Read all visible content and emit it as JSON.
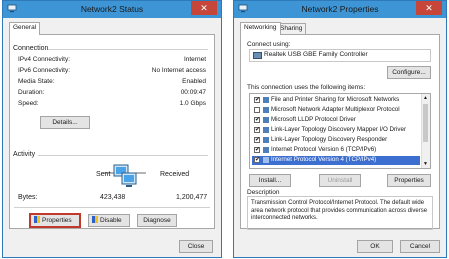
{
  "status_window": {
    "title": "Network2 Status",
    "close_glyph": "✕",
    "tab": "General",
    "connection": {
      "heading": "Connection",
      "rows": [
        {
          "label": "IPv4 Connectivity:",
          "value": "Internet"
        },
        {
          "label": "IPv6 Connectivity:",
          "value": "No Internet access"
        },
        {
          "label": "Media State:",
          "value": "Enabled"
        },
        {
          "label": "Duration:",
          "value": "00:09:47"
        },
        {
          "label": "Speed:",
          "value": "1.0 Gbps"
        }
      ],
      "details_button": "Details..."
    },
    "activity": {
      "heading": "Activity",
      "sent": "Sent",
      "received": "Received",
      "bytes_label": "Bytes:",
      "bytes_sent": "423,438",
      "bytes_received": "1,200,477"
    },
    "buttons": {
      "properties": "Properties",
      "disable": "Disable",
      "diagnose": "Diagnose",
      "close": "Close"
    }
  },
  "properties_window": {
    "title": "Network2 Properties",
    "close_glyph": "✕",
    "tabs": [
      "Networking",
      "Sharing"
    ],
    "connect_using_label": "Connect using:",
    "adapter_name": "Realtek USB GBE Family Controller",
    "configure_button": "Configure...",
    "items_label": "This connection uses the following items:",
    "items": [
      {
        "label": "File and Printer Sharing for Microsoft Networks",
        "checked": true
      },
      {
        "label": "Microsoft Network Adapter Multiplexor Protocol",
        "checked": false
      },
      {
        "label": "Microsoft LLDP Protocol Driver",
        "checked": true
      },
      {
        "label": "Link-Layer Topology Discovery Mapper I/O Driver",
        "checked": true
      },
      {
        "label": "Link-Layer Topology Discovery Responder",
        "checked": true
      },
      {
        "label": "Internet Protocol Version 6 (TCP/IPv6)",
        "checked": true
      },
      {
        "label": "Internet Protocol Version 4 (TCP/IPv4)",
        "checked": true,
        "selected": true
      }
    ],
    "install_button": "Install...",
    "uninstall_button": "Uninstall",
    "properties_button": "Properties",
    "description_heading": "Description",
    "description_text": "Transmission Control Protocol/Internet Protocol. The default wide area network protocol that provides communication across diverse interconnected networks.",
    "ok_button": "OK",
    "cancel_button": "Cancel"
  },
  "colors": {
    "titlebar": "#3d95d6",
    "close": "#c7463a",
    "selection": "#3d6fd0"
  }
}
